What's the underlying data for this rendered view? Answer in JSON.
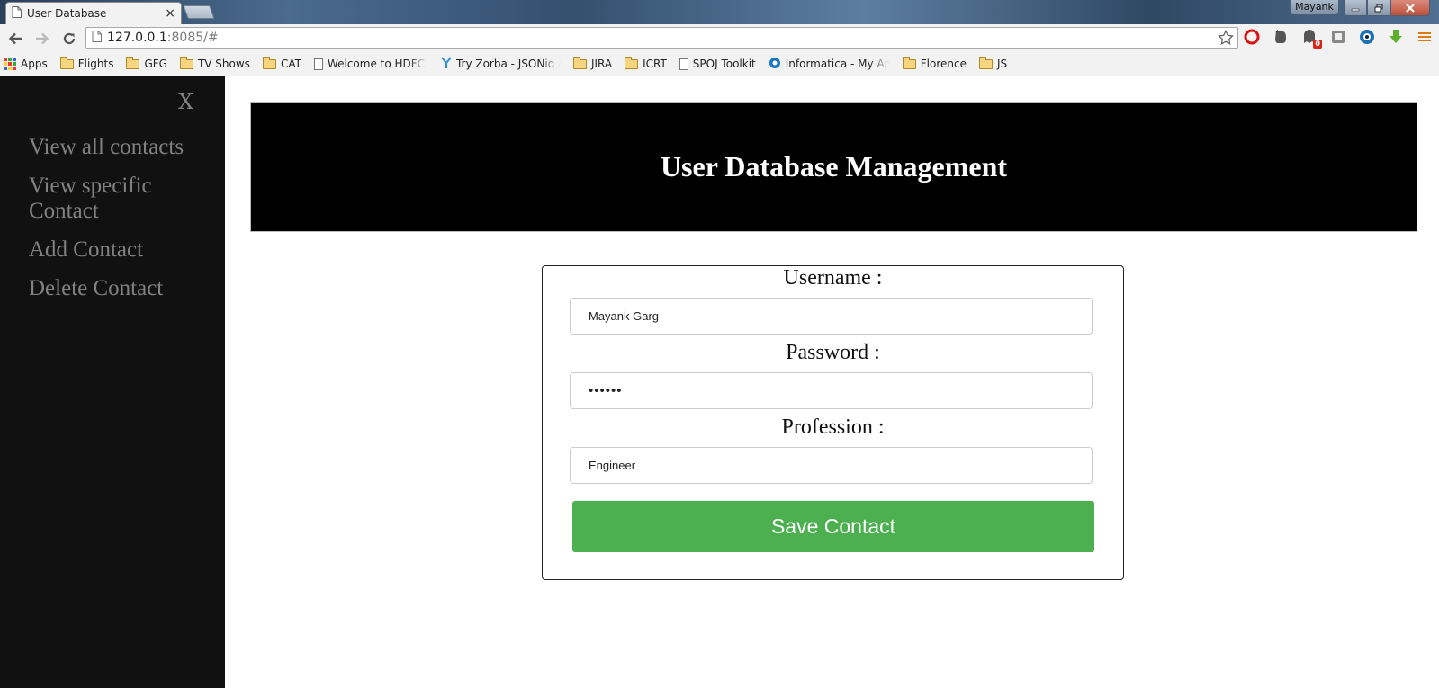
{
  "browser": {
    "tab_title": "User Database",
    "tab_close": "×",
    "profile_name": "Mayank",
    "url_host": "127.0.0.1",
    "url_rest": ":8085/#",
    "ext_badge": "0",
    "bookmarks": [
      {
        "label": "Apps",
        "icon": "apps-grid-icon"
      },
      {
        "label": "Flights",
        "icon": "folder-icon"
      },
      {
        "label": "GFG",
        "icon": "folder-icon"
      },
      {
        "label": "TV Shows",
        "icon": "folder-icon"
      },
      {
        "label": "CAT",
        "icon": "folder-icon"
      },
      {
        "label": "Welcome to HDFC Ba",
        "icon": "page-icon"
      },
      {
        "label": "Try Zorba - JSONiq &",
        "icon": "zorba-icon"
      },
      {
        "label": "JIRA",
        "icon": "folder-icon"
      },
      {
        "label": "ICRT",
        "icon": "folder-icon"
      },
      {
        "label": "SPOJ Toolkit",
        "icon": "page-icon"
      },
      {
        "label": "Informatica - My Appl",
        "icon": "informatica-icon"
      },
      {
        "label": "Florence",
        "icon": "folder-icon"
      },
      {
        "label": "JS",
        "icon": "folder-icon"
      }
    ]
  },
  "sidenav": {
    "close_label": "X",
    "links": [
      "View all contacts",
      "View specific Contact",
      "Add Contact",
      "Delete Contact"
    ]
  },
  "header": {
    "title": "User Database Management"
  },
  "form": {
    "username_label": "Username :",
    "username_value": "Mayank Garg",
    "password_label": "Password :",
    "password_value": "••••••",
    "profession_label": "Profession :",
    "profession_value": "Engineer",
    "save_label": "Save Contact"
  },
  "colors": {
    "sidenav_bg": "#111111",
    "sidenav_text": "#818181",
    "header_bg": "#000000",
    "save_button": "#4caf50"
  }
}
